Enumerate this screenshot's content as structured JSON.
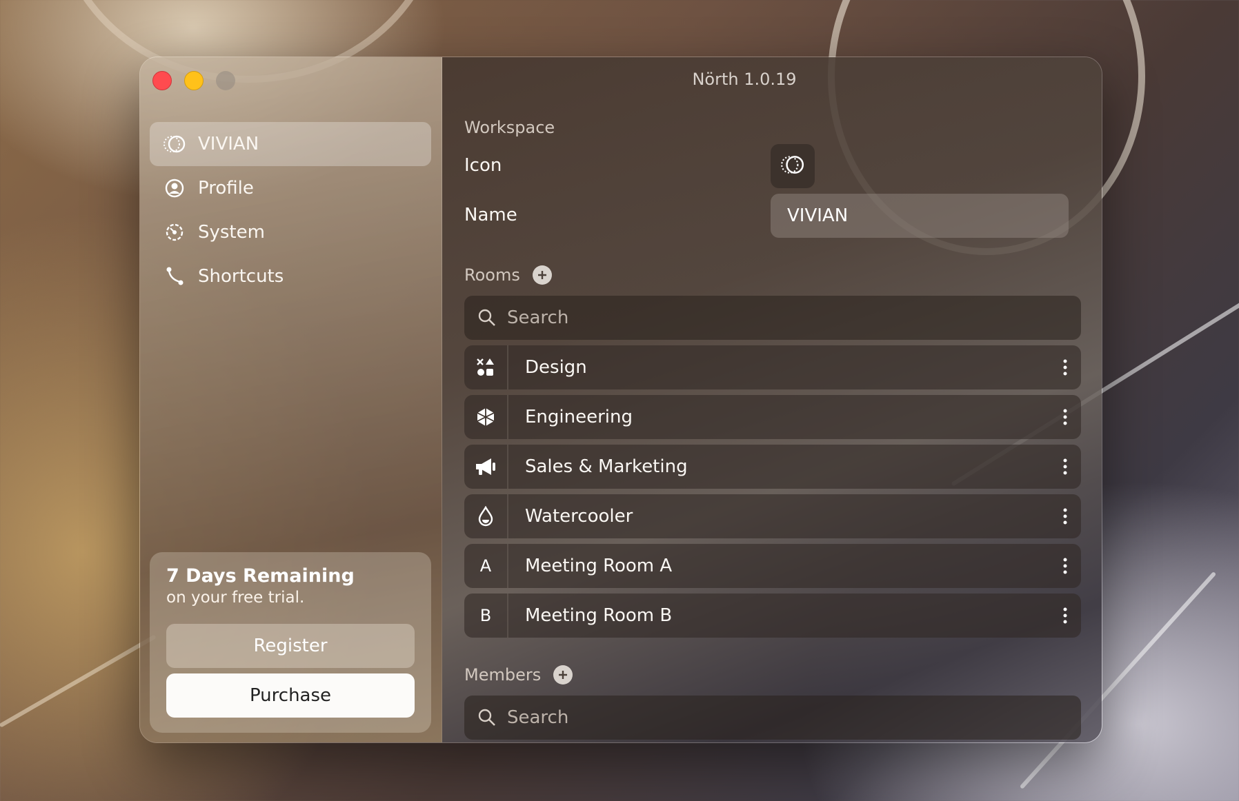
{
  "window": {
    "title": "Nörth 1.0.19"
  },
  "sidebar": {
    "items": [
      {
        "label": "VIVIAN",
        "icon": "workspace-logo-icon",
        "active": true
      },
      {
        "label": "Profile",
        "icon": "person-circle-icon",
        "active": false
      },
      {
        "label": "System",
        "icon": "gear-icon",
        "active": false
      },
      {
        "label": "Shortcuts",
        "icon": "shortcut-path-icon",
        "active": false
      }
    ],
    "trial": {
      "title": "7 Days Remaining",
      "subtitle": "on your free trial.",
      "register_label": "Register",
      "purchase_label": "Purchase"
    }
  },
  "workspace": {
    "section_label": "Workspace",
    "icon_label": "Icon",
    "name_label": "Name",
    "name_value": "VIVIAN"
  },
  "rooms": {
    "section_label": "Rooms",
    "search_placeholder": "Search",
    "items": [
      {
        "name": "Design",
        "icon": "shapes-icon"
      },
      {
        "name": "Engineering",
        "icon": "cube-icon"
      },
      {
        "name": "Sales & Marketing",
        "icon": "megaphone-icon"
      },
      {
        "name": "Watercooler",
        "icon": "water-drop-icon"
      },
      {
        "name": "Meeting Room A",
        "icon_letter": "A"
      },
      {
        "name": "Meeting Room B",
        "icon_letter": "B"
      }
    ]
  },
  "members": {
    "section_label": "Members",
    "search_placeholder": "Search"
  },
  "colors": {
    "close": "#ff4b4f",
    "minimize": "#ffc11a",
    "purchase_bg": "#fcfbf9"
  }
}
